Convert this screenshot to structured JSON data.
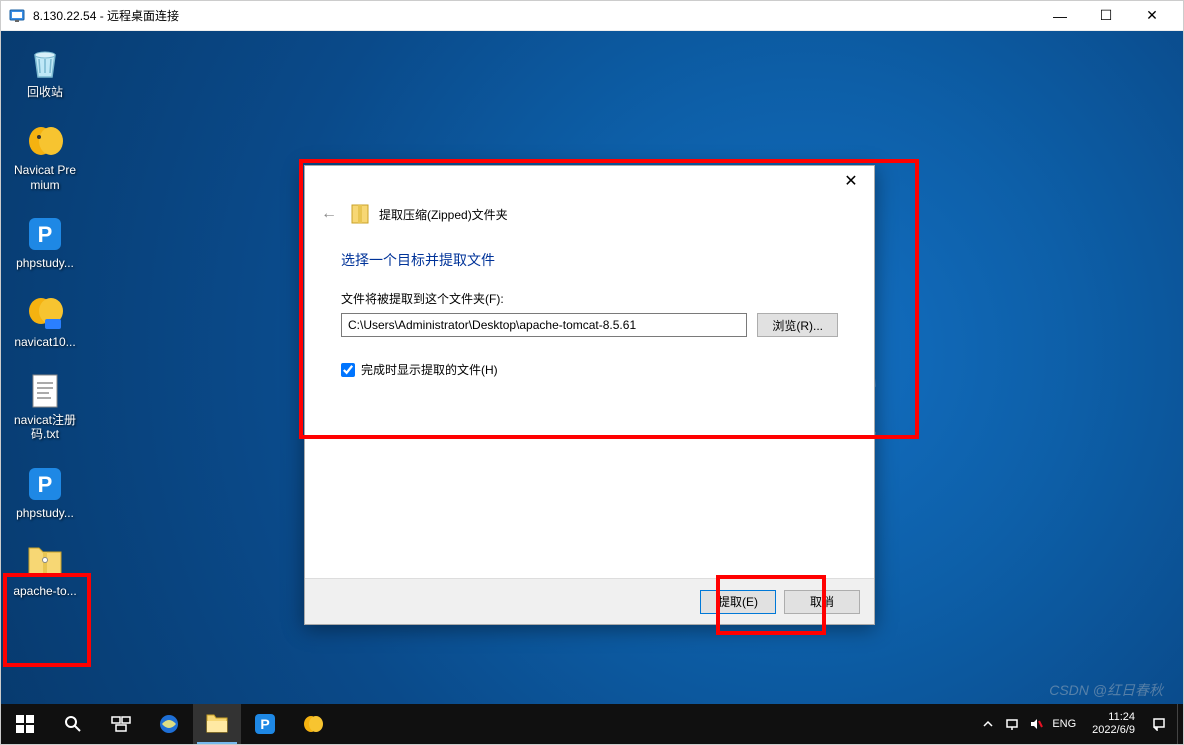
{
  "rdp": {
    "title": "8.130.22.54 - 远程桌面连接"
  },
  "desktop_icons": [
    {
      "name": "recycle-bin",
      "label": "回收站"
    },
    {
      "name": "navicat-premium",
      "label": "Navicat Premium"
    },
    {
      "name": "phpstudy-1",
      "label": "phpstudy..."
    },
    {
      "name": "navicat-10",
      "label": "navicat10..."
    },
    {
      "name": "navicat-reg-txt",
      "label": "navicat注册码.txt"
    },
    {
      "name": "phpstudy-2",
      "label": "phpstudy..."
    },
    {
      "name": "apache-tomcat-zip",
      "label": "apache-to..."
    }
  ],
  "dialog": {
    "header": "提取压缩(Zipped)文件夹",
    "title": "选择一个目标并提取文件",
    "field_label": "文件将被提取到这个文件夹(F):",
    "path": "C:\\Users\\Administrator\\Desktop\\apache-tomcat-8.5.61",
    "browse": "浏览(R)...",
    "checkbox_label": "完成时显示提取的文件(H)",
    "checkbox_checked": true,
    "extract_btn": "提取(E)",
    "cancel_btn": "取消"
  },
  "taskbar": {
    "lang": "ENG",
    "time": "11:24",
    "date": "2022/6/9"
  },
  "watermark": "CSDN @红日春秋"
}
